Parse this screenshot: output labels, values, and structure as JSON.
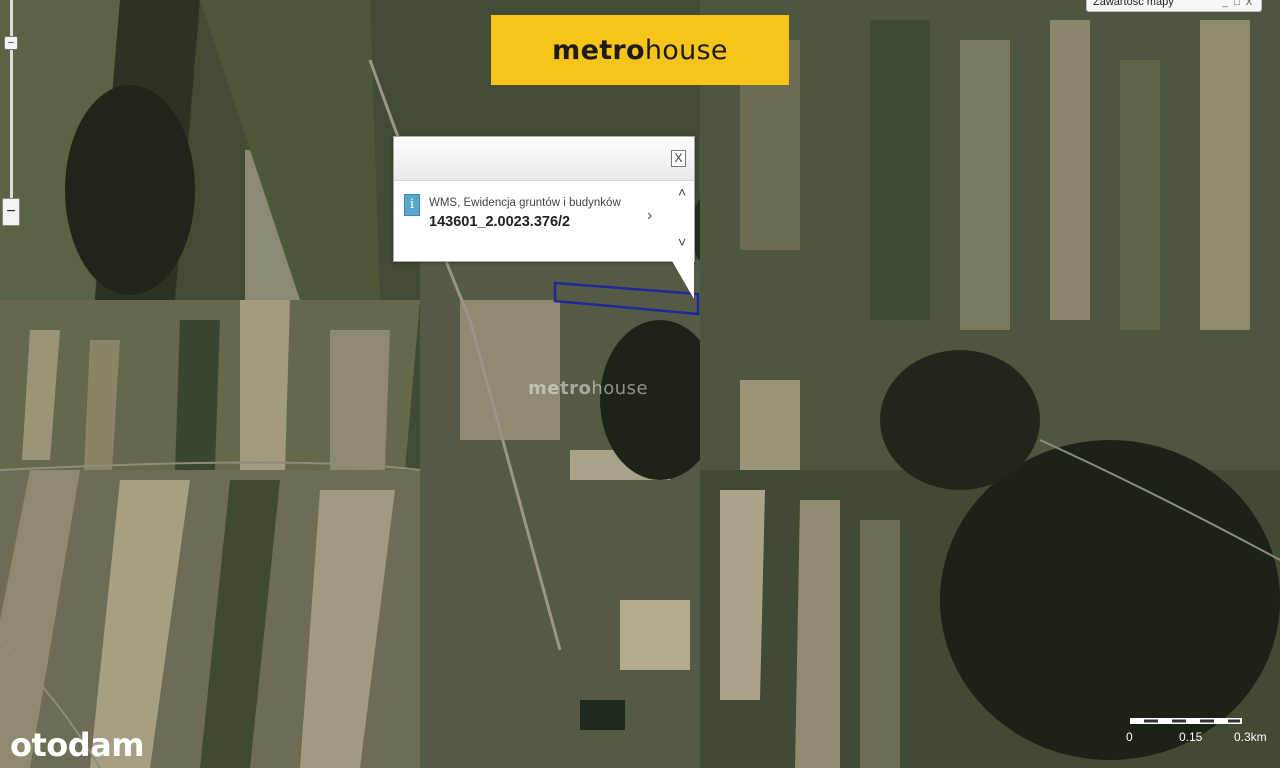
{
  "brand": {
    "name_bold": "metro",
    "name_regular": "house",
    "color": "#f7c51a"
  },
  "watermark": {
    "bold": "metro",
    "regular": "house"
  },
  "portal_logo": "otodam",
  "map_menu": {
    "label": "Zawartość mapy",
    "controls": [
      "_",
      "□",
      "X"
    ]
  },
  "zoom": {
    "out_label": "−",
    "handle_label": "−"
  },
  "popup": {
    "close_label": "X",
    "info_icon": "i",
    "layer_name": "WMS, Ewidencja gruntów i budynków",
    "parcel_id": "143601_2.0023.376/2",
    "next_label": "›",
    "up_label": "˄",
    "down_label": "˅"
  },
  "parcel": {
    "outline_color": "#1e2a9c"
  },
  "scale": {
    "labels": [
      "0",
      "0.15",
      "0.3km"
    ]
  }
}
